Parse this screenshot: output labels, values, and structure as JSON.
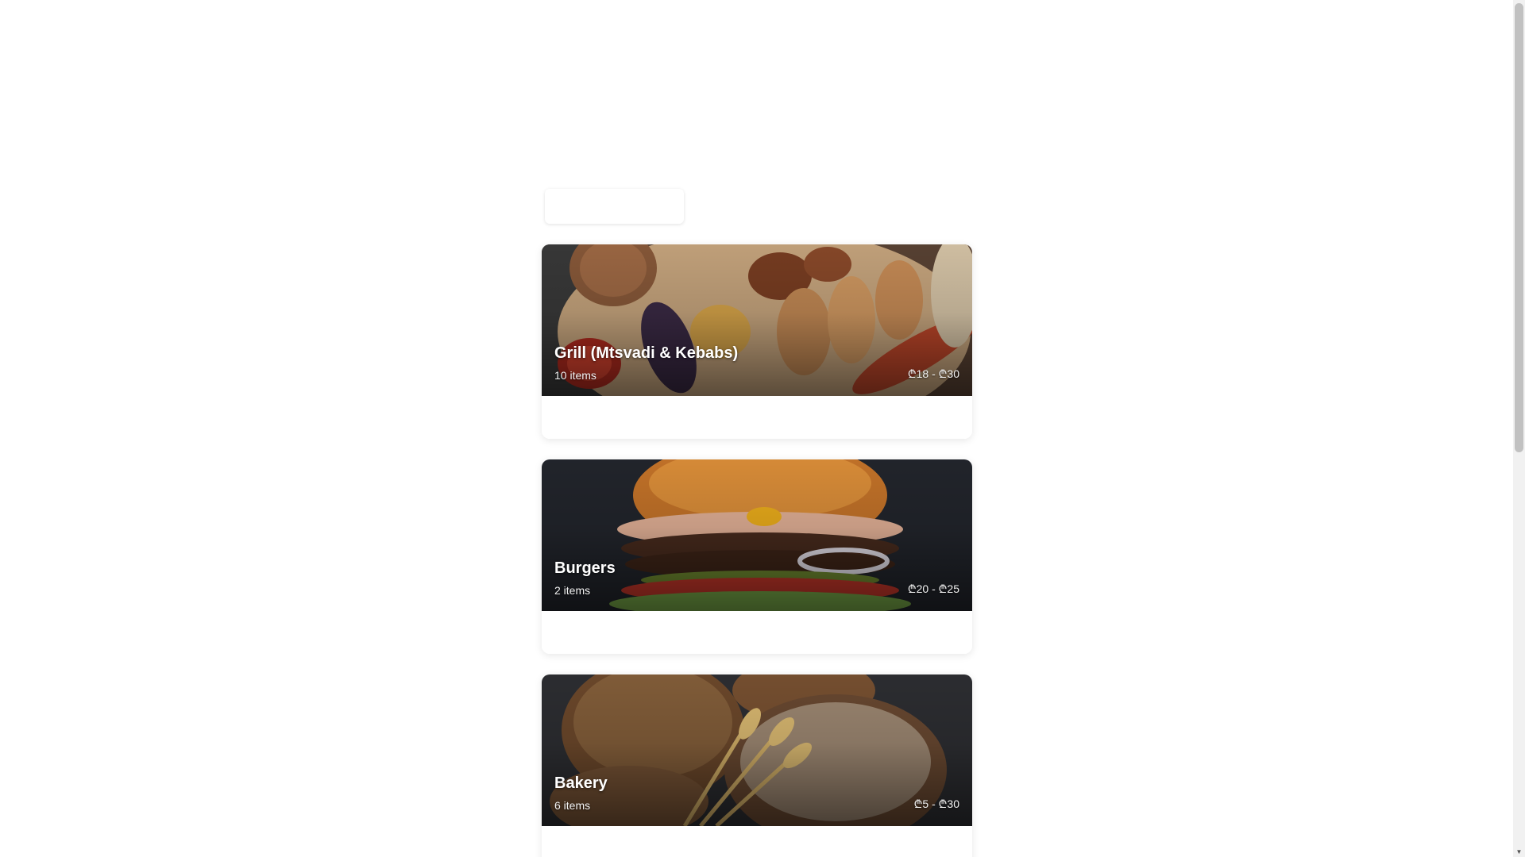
{
  "categories": [
    {
      "title": "Grill (Mtsvadi & Kebabs)",
      "items_count": "10 items",
      "price_range": "₾18 - ₾30",
      "image": "grill-image"
    },
    {
      "title": "Burgers",
      "items_count": "2 items",
      "price_range": "₾20 - ₾25",
      "image": "burger-image"
    },
    {
      "title": "Bakery",
      "items_count": "6 items",
      "price_range": "₾5 - ₾30",
      "image": "bread-image"
    }
  ],
  "scrollbar": {
    "down_arrow_icon": "chevron-down-icon"
  },
  "colors": {
    "card_text": "#ffffff",
    "background": "#ffffff"
  }
}
